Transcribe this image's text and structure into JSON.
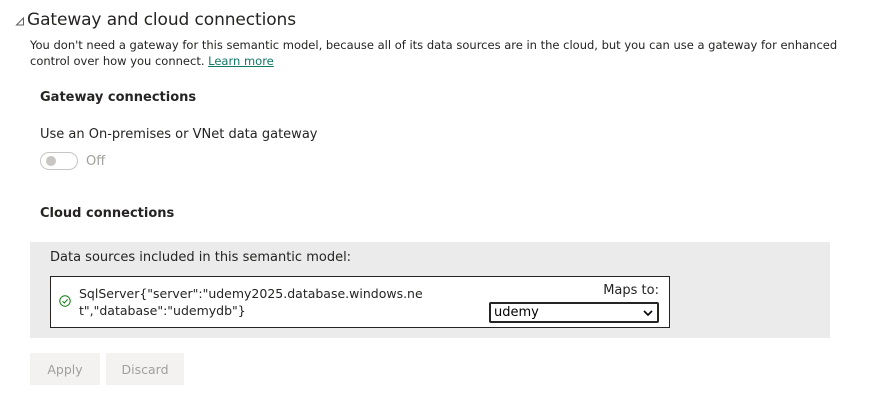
{
  "section": {
    "title": "Gateway and cloud connections",
    "description": "You don't need a gateway for this semantic model, because all of its data sources are in the cloud, but you can use a gateway for enhanced control over how you connect.",
    "learn_more": "Learn more"
  },
  "gateway": {
    "heading": "Gateway connections",
    "toggle_label": "Use an On-premises or VNet data gateway",
    "toggle_state": "Off"
  },
  "cloud": {
    "heading": "Cloud connections",
    "panel_label": "Data sources included in this semantic model:",
    "data_source": "SqlServer{\"server\":\"udemy2025.database.windows.net\",\"database\":\"udemydb\"}",
    "maps_to_label": "Maps to:",
    "maps_to_value": "udemy"
  },
  "buttons": {
    "apply": "Apply",
    "discard": "Discard"
  },
  "colors": {
    "link": "#117865",
    "panel_bg": "#ebebeb",
    "success_icon": "#107c10",
    "disabled_text": "#a19f9d"
  },
  "icons": {
    "collapse": "collapse-triangle-icon",
    "status": "checkmark-circle-icon",
    "dropdown": "chevron-down-icon"
  }
}
